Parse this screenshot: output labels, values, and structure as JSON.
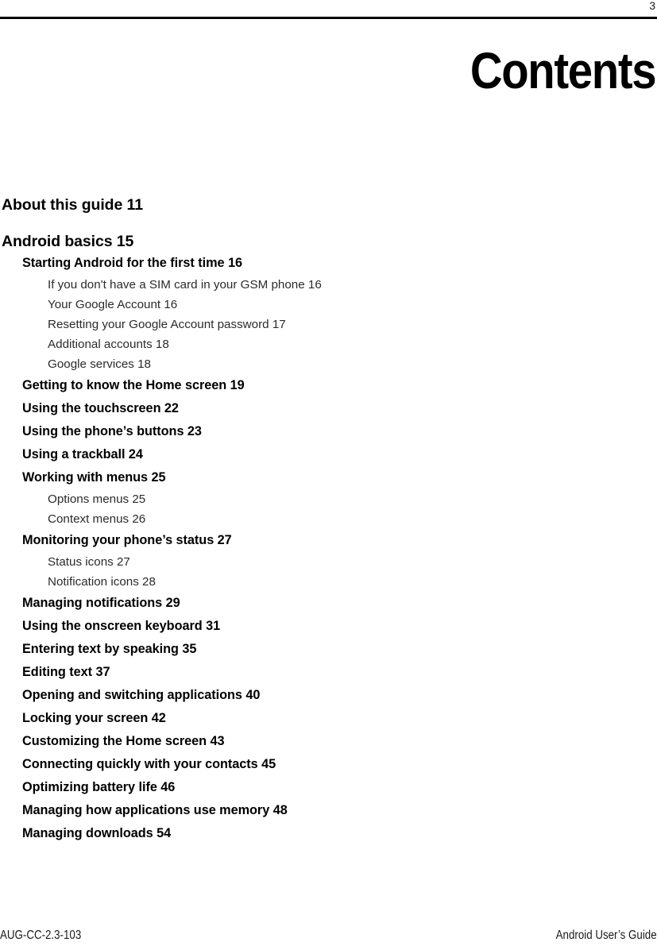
{
  "header": {
    "page_number": "3"
  },
  "title": "Contents",
  "toc": [
    {
      "level": 1,
      "text": "About this guide 11"
    },
    {
      "level": 1,
      "text": "Android basics 15"
    },
    {
      "level": 2,
      "text": "Starting Android for the first time 16"
    },
    {
      "level": 3,
      "text": "If you don't have a SIM card in your GSM phone 16"
    },
    {
      "level": 3,
      "text": "Your Google Account 16"
    },
    {
      "level": 3,
      "text": "Resetting your Google Account password 17"
    },
    {
      "level": 3,
      "text": "Additional accounts 18"
    },
    {
      "level": 3,
      "text": "Google services 18"
    },
    {
      "level": 2,
      "text": "Getting to know the Home screen 19"
    },
    {
      "level": 2,
      "text": "Using the touchscreen 22"
    },
    {
      "level": 2,
      "text": "Using the phone’s buttons 23"
    },
    {
      "level": 2,
      "text": "Using a trackball 24"
    },
    {
      "level": 2,
      "text": "Working with menus 25"
    },
    {
      "level": 3,
      "text": "Options menus 25"
    },
    {
      "level": 3,
      "text": "Context menus 26"
    },
    {
      "level": 2,
      "text": "Monitoring your phone’s status 27"
    },
    {
      "level": 3,
      "text": "Status icons 27"
    },
    {
      "level": 3,
      "text": "Notification icons 28"
    },
    {
      "level": 2,
      "text": "Managing notifications 29"
    },
    {
      "level": 2,
      "text": "Using the onscreen keyboard 31"
    },
    {
      "level": 2,
      "text": "Entering text by speaking 35"
    },
    {
      "level": 2,
      "text": "Editing text 37"
    },
    {
      "level": 2,
      "text": "Opening and switching applications 40"
    },
    {
      "level": 2,
      "text": "Locking your screen 42"
    },
    {
      "level": 2,
      "text": "Customizing the Home screen 43"
    },
    {
      "level": 2,
      "text": "Connecting quickly with your contacts 45"
    },
    {
      "level": 2,
      "text": "Optimizing battery life 46"
    },
    {
      "level": 2,
      "text": "Managing how applications use memory 48"
    },
    {
      "level": 2,
      "text": "Managing downloads 54"
    }
  ],
  "footer": {
    "left": "AUG-CC-2.3-103",
    "right": "Android User’s Guide"
  }
}
